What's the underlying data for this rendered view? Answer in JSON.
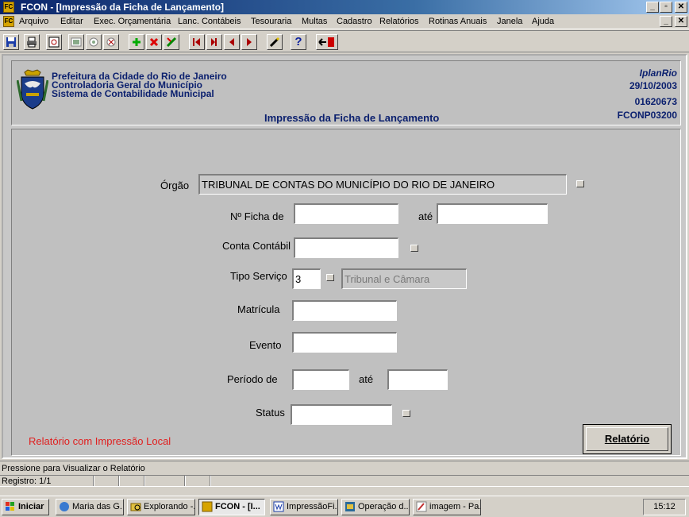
{
  "window": {
    "title": "FCON - [Impressão da Ficha de Lançamento]",
    "controls": {
      "minimize": "_",
      "restore": "▫",
      "close": "✕"
    }
  },
  "menu": [
    "Arquivo",
    "Editar",
    "Exec. Orçamentária",
    "Lanc. Contábeis",
    "Tesouraria",
    "Multas",
    "Cadastro",
    "Relatórios",
    "Rotinas Anuais",
    "Janela",
    "Ajuda"
  ],
  "toolbar": {
    "icons": [
      "save-icon",
      "print-icon",
      "preview-icon",
      "execute-query-icon",
      "enter-query-icon",
      "cancel-query-icon",
      "insert-record-icon",
      "delete-record-icon",
      "clear-icon",
      "first-record-icon",
      "previous-block-icon",
      "previous-record-icon",
      "next-record-icon",
      "edit-icon",
      "help-icon",
      "exit-icon"
    ],
    "help_label": "?"
  },
  "header": {
    "org_line1": "Prefeitura da Cidade do Rio de Janeiro",
    "org_line2": "Controladoria Geral do Município",
    "org_line3": "Sistema de Contabilidade Municipal",
    "brand": "IplanRio",
    "date": "29/10/2003",
    "user_code": "01620673",
    "form_code": "FCONP03200",
    "form_title": "Impressão  da Ficha de Lançamento"
  },
  "form": {
    "orgao": {
      "label": "Órgão",
      "value": "TRIBUNAL DE CONTAS DO MUNICÍPIO DO RIO DE JANEIRO"
    },
    "ficha": {
      "label": "Nº Ficha de",
      "value_from": "",
      "until_label": "até",
      "value_to": ""
    },
    "conta": {
      "label": "Conta Contábil",
      "value": ""
    },
    "tipo_servico": {
      "label": "Tipo Serviço",
      "code": "3",
      "description": "Tribunal e Câmara"
    },
    "matricula": {
      "label": "Matrícula",
      "value": ""
    },
    "evento": {
      "label": "Evento",
      "value": ""
    },
    "periodo": {
      "label": "Período de",
      "value_from": "",
      "until_label": "até",
      "value_to": ""
    },
    "status": {
      "label": "Status",
      "value": ""
    },
    "local_note": "Relatório com Impressão Local",
    "report_button": "Relatório"
  },
  "status_bar": {
    "hint": "Pressione para Visualizar o Relatório",
    "record": "Registro: 1/1"
  },
  "taskbar": {
    "start": "Iniciar",
    "tasks": [
      "Maria das G...",
      "Explorando -...",
      "FCON - [I...",
      "ImpressãoFi...",
      "Operação d...",
      "imagem - Pa..."
    ],
    "clock": "15:12"
  },
  "colors": {
    "title_bar": "#0a246a",
    "header_text": "#0a1f6e",
    "note": "#e02020",
    "window_bg": "#d4d0c8"
  }
}
